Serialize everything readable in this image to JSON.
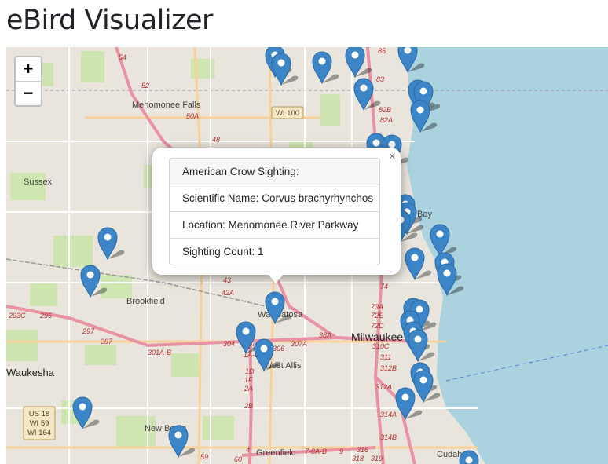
{
  "page": {
    "title": "eBird Visualizer"
  },
  "zoom": {
    "in_label": "+",
    "out_label": "−"
  },
  "popup": {
    "close_label": "×",
    "items": [
      "American Crow Sighting:",
      "Scientific Name: Corvus brachyrhynchos",
      "Location: Menomonee River Parkway",
      "Sighting Count: 1"
    ]
  },
  "map_labels": {
    "places": [
      "Menomonee Falls",
      "Sussex",
      "Brookfield",
      "Wauwatosa",
      "Milwaukee",
      "West Allis",
      "Waukesha",
      "New Berlin",
      "Greenfield",
      "Cudahy",
      "Bay"
    ],
    "shields": [
      "WI 100",
      "US 18",
      "WI 59",
      "WI 164"
    ],
    "exits": [
      "54",
      "52",
      "50A",
      "48",
      "85",
      "83",
      "82B",
      "82A",
      "43",
      "42A",
      "295",
      "293C",
      "297",
      "297",
      "304",
      "39",
      "306",
      "307A",
      "38A",
      "73A",
      "72E",
      "72D",
      "310C",
      "311",
      "312B",
      "312A",
      "314A",
      "314B",
      "301A-B",
      "1D",
      "1F",
      "2A",
      "2B",
      "1A-B",
      "4",
      "7-8A-B",
      "9",
      "316",
      "318",
      "319",
      "59",
      "60",
      "74"
    ]
  },
  "markers": {
    "count": 34,
    "color": "#3c86c8",
    "icon": "map-marker-icon"
  },
  "colors": {
    "water": "#aad3df",
    "land": "#e9e5dc",
    "park": "#cde6ab",
    "highway": "#e892a2"
  }
}
